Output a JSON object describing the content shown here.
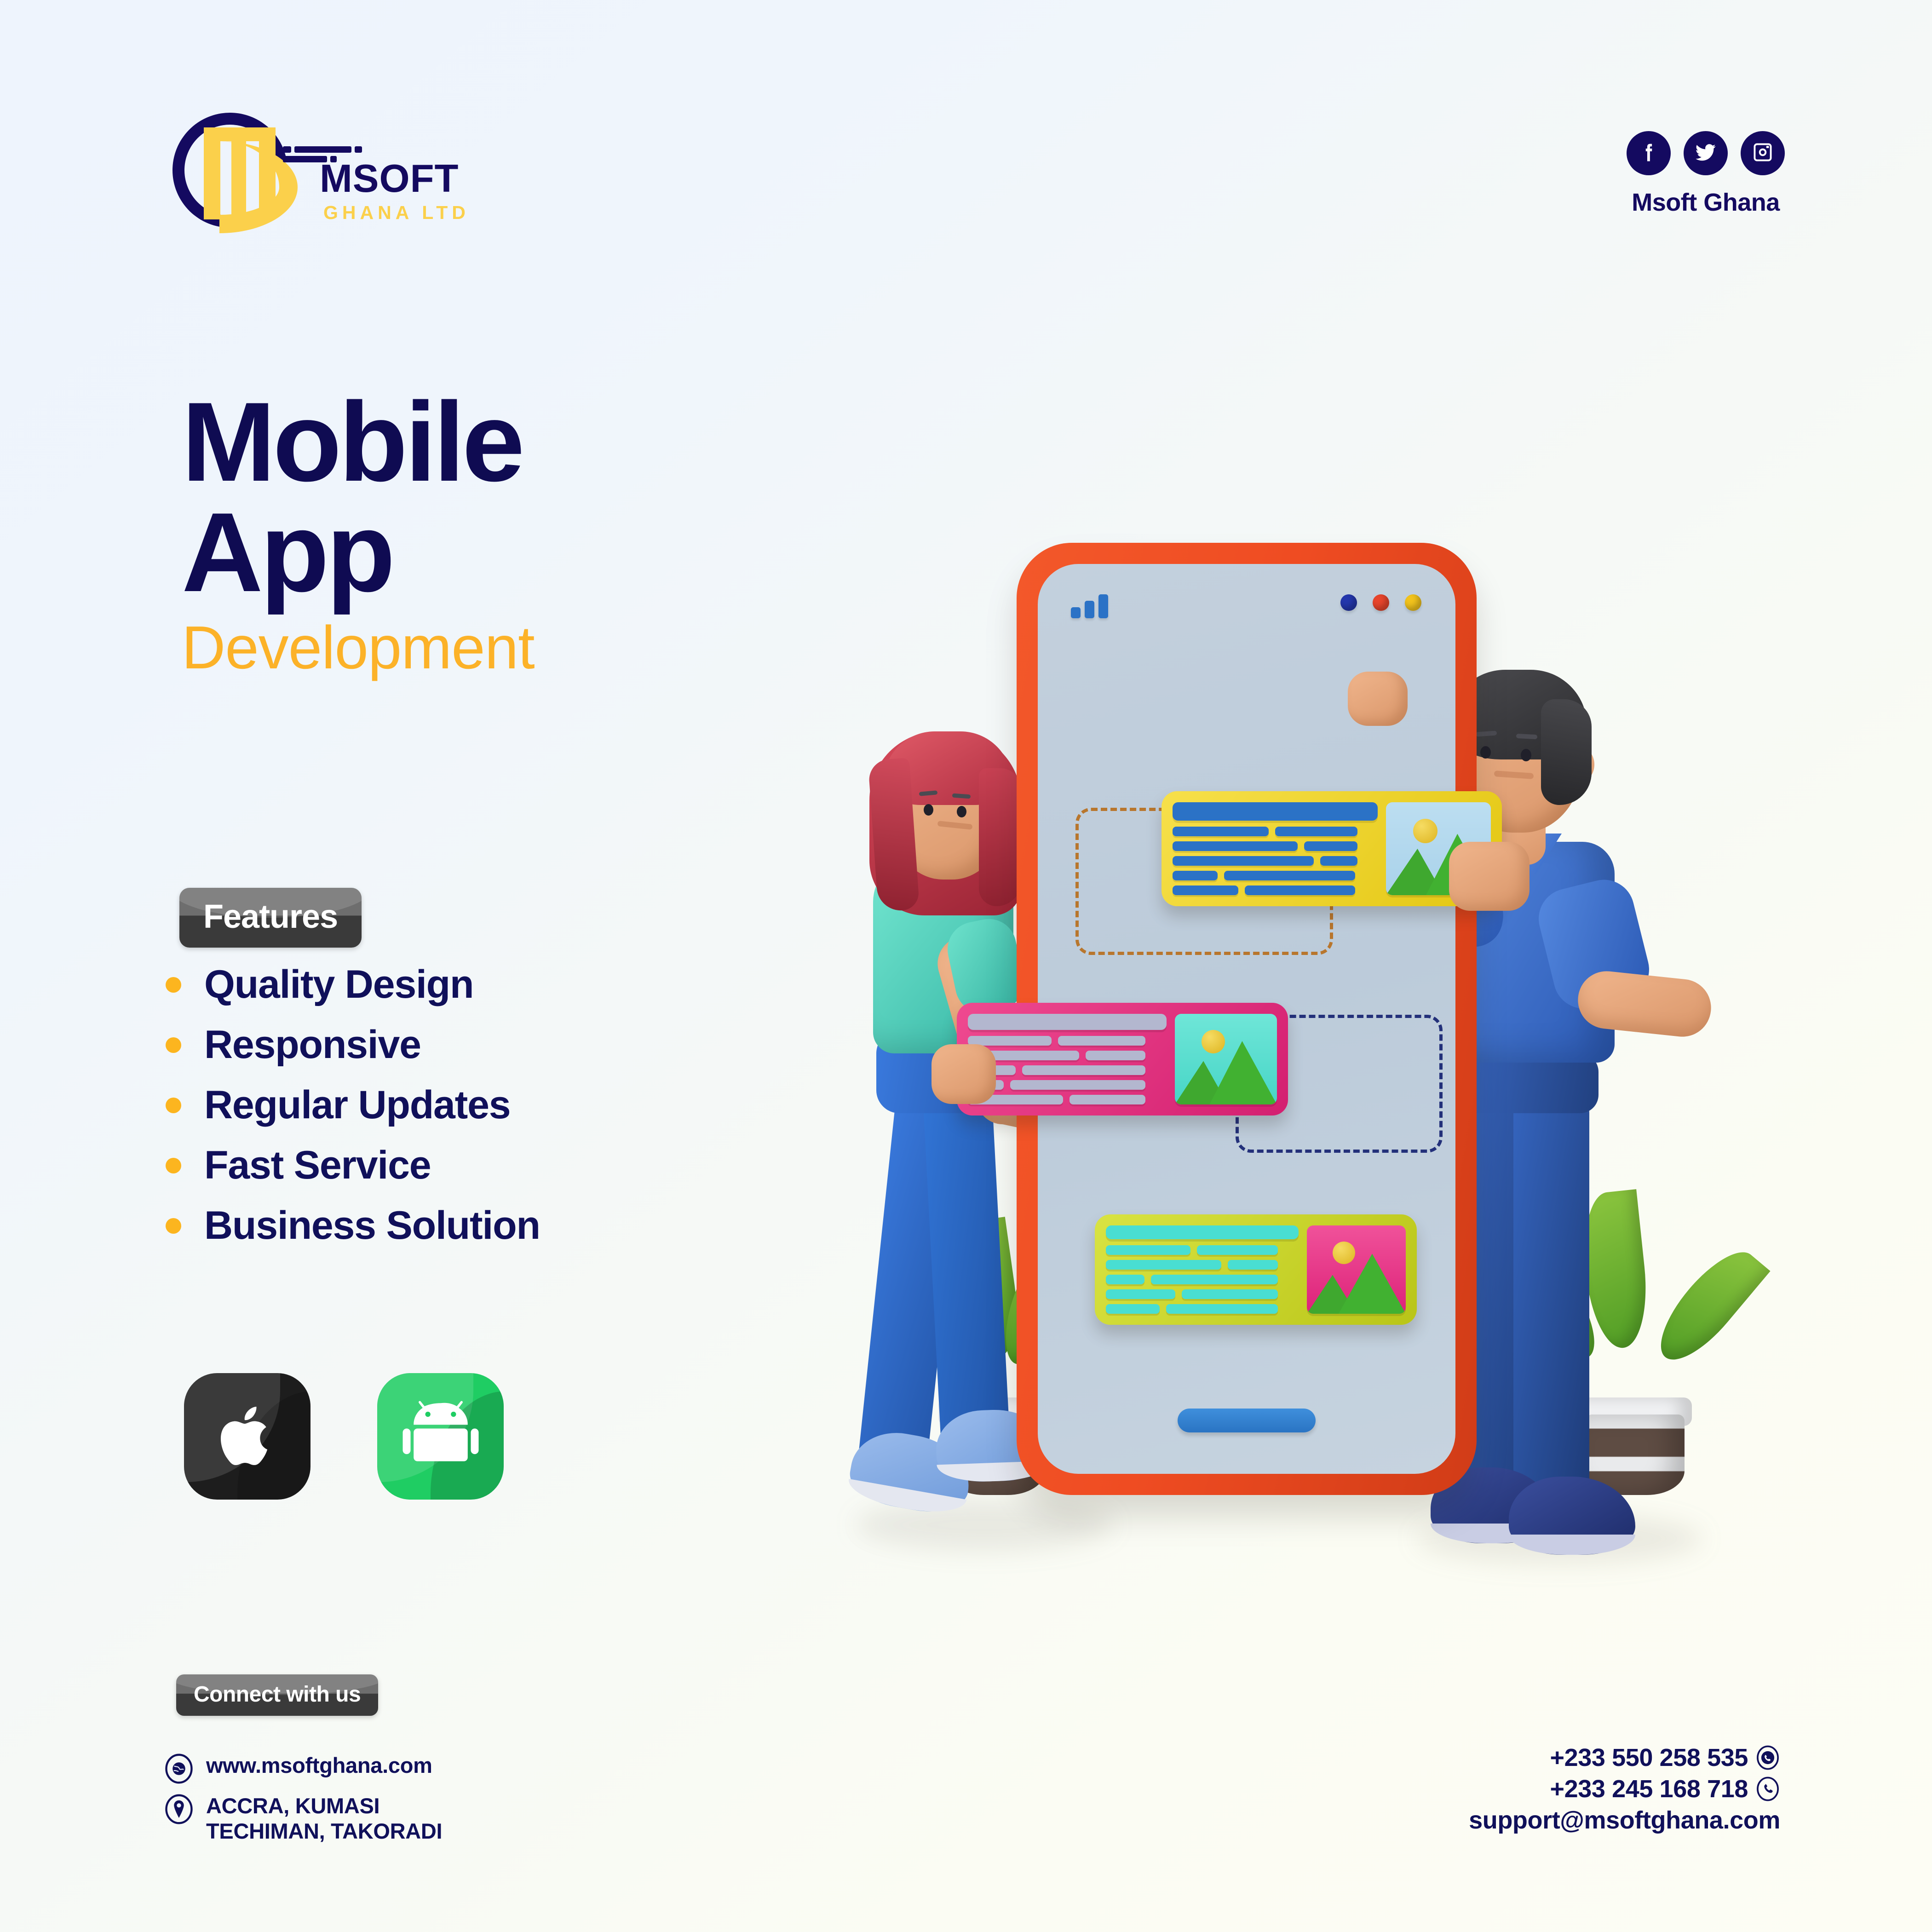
{
  "brand": {
    "logo_name": "MSOFT",
    "logo_sub": "GHANA LTD",
    "logo_icon": "msoft-monogram-icon"
  },
  "social": {
    "handle": "Msoft Ghana",
    "items": [
      {
        "name": "facebook",
        "icon": "facebook-icon"
      },
      {
        "name": "twitter",
        "icon": "twitter-icon"
      },
      {
        "name": "instagram",
        "icon": "instagram-icon"
      }
    ]
  },
  "headline": {
    "line1": "Mobile",
    "line2": "App",
    "subtitle": "Development"
  },
  "features": {
    "badge_label": "Features",
    "items": [
      {
        "label": "Quality Design"
      },
      {
        "label": "Responsive"
      },
      {
        "label": "Regular Updates"
      },
      {
        "label": "Fast Service"
      },
      {
        "label": "Business Solution"
      }
    ]
  },
  "platforms": [
    {
      "name": "ios",
      "icon": "apple-icon"
    },
    {
      "name": "android",
      "icon": "android-icon"
    }
  ],
  "footer": {
    "connect_label": "Connect with us",
    "website": "www.msoftghana.com",
    "address_line1": "ACCRA, KUMASI",
    "address_line2": "TECHIMAN, TAKORADI",
    "phone_whatsapp": "+233 550 258 535",
    "phone_call": "+233 245 168 718",
    "email": "support@msoftghana.com",
    "icons": {
      "website": "globe-icon",
      "address": "location-pin-icon",
      "whatsapp": "whatsapp-icon",
      "phone": "phone-icon"
    }
  },
  "illustration": {
    "name": "mobile-app-development-3d-illustration",
    "phone": {
      "frame_color": "#ef4c22",
      "screen_color": "#c3d0dd",
      "status_icon": "signal-bars-icon",
      "dot_colors": [
        "#2437ad",
        "#e8452c",
        "#f2c31c"
      ],
      "home_indicator_color": "#2f7cc9"
    },
    "cards": [
      {
        "name": "card-yellow",
        "frame": "#f5d92b",
        "accent": "#2b72c6",
        "image_bg": "#aed4ea"
      },
      {
        "name": "card-pink",
        "frame": "#e8357f",
        "accent": "#b3b7cf",
        "image_bg": "#55dcd2"
      },
      {
        "name": "card-lime",
        "frame": "#c8d32c",
        "accent": "#49ded2",
        "image_bg": "#e8357f"
      }
    ],
    "people": [
      {
        "name": "woman",
        "hair": "#c4334a",
        "shirt": "#56d7c2",
        "pants": "#2f6fd0",
        "shoes": "#7fa7e0"
      },
      {
        "name": "man",
        "hair": "#3a3a3c",
        "shirt": "#3a72d2",
        "pants": "#2a4f9c",
        "shoes": "#26387e"
      }
    ],
    "plants": [
      {
        "name": "plant-left",
        "leaf": "#6eb52f",
        "pot": "#5e4c43"
      },
      {
        "name": "plant-right",
        "leaf": "#6eb52f",
        "pot": "#5e4c43"
      }
    ]
  },
  "colors": {
    "navy": "#10105a",
    "amber": "#fcb51f",
    "yellow": "#fbd04b",
    "orange_frame": "#ef4c22",
    "bg_top_left": "#eef4fd",
    "bg_bottom_right": "#fdfdf4"
  }
}
